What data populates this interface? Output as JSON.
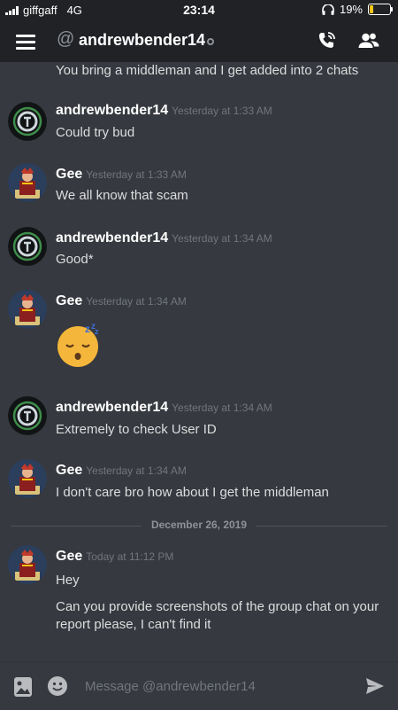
{
  "status_bar": {
    "carrier": "giffgaff",
    "network": "4G",
    "time": "23:14",
    "battery": "19%",
    "battery_level": 0.19
  },
  "header": {
    "title": "andrewbender14",
    "menu_icon": "hamburger-menu-icon",
    "call_icon": "call-icon",
    "members_icon": "members-icon"
  },
  "messages": {
    "partial_text": "You bring a middleman and I get added into 2 chats",
    "m1": {
      "author": "andrewbender14",
      "time": "Yesterday at 1:33 AM",
      "text": "Could try bud"
    },
    "m2": {
      "author": "Gee",
      "time": "Yesterday at 1:33 AM",
      "text": "We all know that scam"
    },
    "m3": {
      "author": "andrewbender14",
      "time": "Yesterday at 1:34 AM",
      "text": "Good*"
    },
    "m4": {
      "author": "Gee",
      "time": "Yesterday at 1:34 AM",
      "text": "😴"
    },
    "m5": {
      "author": "andrewbender14",
      "time": "Yesterday at 1:34 AM",
      "text": "Extremely to check User ID"
    },
    "m6": {
      "author": "Gee",
      "time": "Yesterday at 1:34 AM",
      "text": "I don't care bro how about I get the middleman"
    },
    "date_divider": "December 26, 2019",
    "m7": {
      "author": "Gee",
      "time": "Today at 11:12 PM",
      "text": "Hey",
      "text2": "Can you provide screenshots of the group chat on your report please, I can't find it"
    }
  },
  "composer": {
    "placeholder": "Message @andrewbender14",
    "image_icon": "image-upload-icon",
    "emoji_icon": "emoji-icon",
    "send_icon": "send-icon"
  },
  "colors": {
    "background": "#36393f",
    "header": "#202225",
    "timestamp": "#72767d",
    "battery": "#f5c518"
  }
}
